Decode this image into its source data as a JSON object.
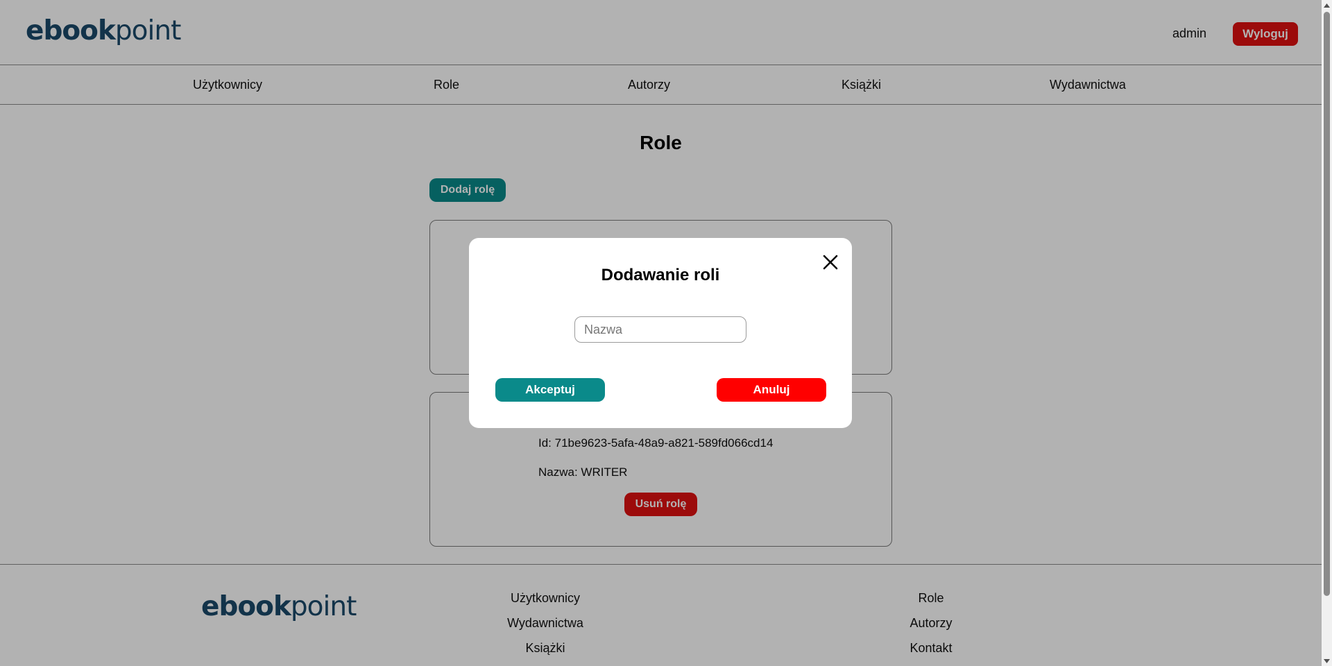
{
  "header": {
    "logo": {
      "bold": "ebook",
      "light": "point"
    },
    "user": "admin",
    "logout_label": "Wyloguj"
  },
  "nav": {
    "items": [
      {
        "label": "Użytkownicy"
      },
      {
        "label": "Role"
      },
      {
        "label": "Autorzy"
      },
      {
        "label": "Książki"
      },
      {
        "label": "Wydawnictwa"
      }
    ]
  },
  "main": {
    "title": "Role",
    "add_role_label": "Dodaj rolę",
    "roles": [
      {
        "id_text": "Id: 71be9623-5afa-48a9-a821-589fd066cd14",
        "name_text": "Nazwa: WRITER",
        "delete_label": "Usuń rolę"
      }
    ]
  },
  "modal": {
    "title": "Dodawanie roli",
    "name_placeholder": "Nazwa",
    "name_value": "",
    "accept_label": "Akceptuj",
    "cancel_label": "Anuluj"
  },
  "footer": {
    "logo": {
      "bold": "ebook",
      "light": "point"
    },
    "links_left": [
      {
        "label": "Użytkownicy"
      },
      {
        "label": "Wydawnictwa"
      },
      {
        "label": "Książki"
      }
    ],
    "links_right": [
      {
        "label": "Role"
      },
      {
        "label": "Autorzy"
      },
      {
        "label": "Kontakt"
      }
    ]
  },
  "colors": {
    "accent_teal": "#0a8a8a",
    "danger_red": "#e01010",
    "logo_blue": "#1a4a6a"
  }
}
